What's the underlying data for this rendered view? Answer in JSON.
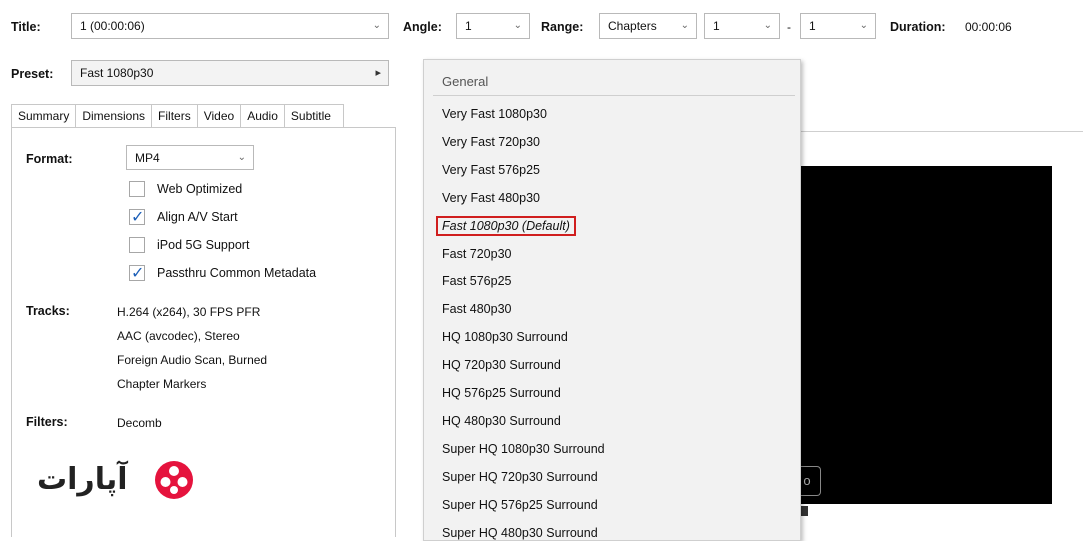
{
  "toolbar": {
    "title_label": "Title:",
    "title_value": "1 (00:00:06)",
    "angle_label": "Angle:",
    "angle_value": "1",
    "range_label": "Range:",
    "range_type": "Chapters",
    "range_from": "1",
    "range_sep": "-",
    "range_to": "1",
    "duration_label": "Duration:",
    "duration_value": "00:00:06"
  },
  "preset": {
    "label": "Preset:",
    "value": "Fast 1080p30",
    "arrow": "▸"
  },
  "tabs": [
    "Summary",
    "Dimensions",
    "Filters",
    "Video",
    "Audio",
    "Subtitle"
  ],
  "summary": {
    "format_label": "Format:",
    "format_value": "MP4",
    "options": [
      {
        "label": "Web Optimized",
        "checked": false
      },
      {
        "label": "Align A/V Start",
        "checked": true
      },
      {
        "label": "iPod 5G Support",
        "checked": false
      },
      {
        "label": "Passthru Common Metadata",
        "checked": true
      }
    ],
    "tracks_label": "Tracks:",
    "tracks": [
      "H.264 (x264), 30 FPS PFR",
      "AAC (avcodec), Stereo",
      "Foreign Audio Scan, Burned",
      "Chapter Markers"
    ],
    "filters_label": "Filters:",
    "filters_value": "Decomb"
  },
  "watermark": {
    "text": "آپارات"
  },
  "menu": {
    "header": "General",
    "items": [
      "Very Fast 1080p30",
      "Very Fast 720p30",
      "Very Fast 576p25",
      "Very Fast 480p30",
      "Fast 1080p30 (Default)",
      "Fast 720p30",
      "Fast 576p25",
      "Fast 480p30",
      "HQ 1080p30 Surround",
      "HQ 720p30 Surround",
      "HQ 576p25 Surround",
      "HQ 480p30 Surround",
      "Super HQ 1080p30 Surround",
      "Super HQ 720p30 Surround",
      "Super HQ 576p25 Surround",
      "Super HQ 480p30 Surround"
    ],
    "selected_index": 4
  },
  "preview": {
    "overlay_char": "o"
  },
  "colors": {
    "highlight_border": "#d01e1e",
    "check": "#1c5fb8",
    "preview_bg": "#000000",
    "logo_red": "#e5133d"
  }
}
